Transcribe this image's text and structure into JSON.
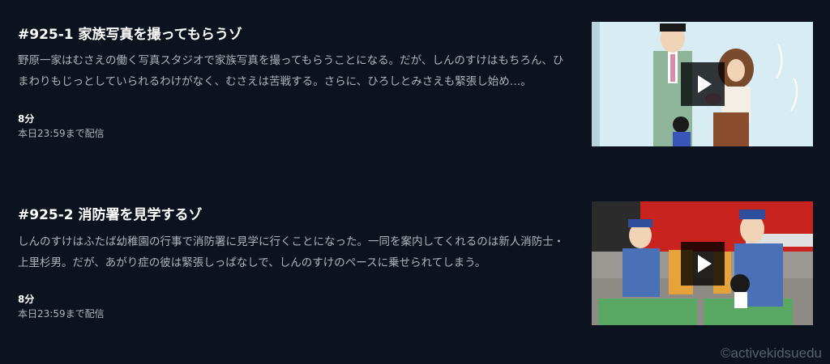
{
  "episodes": [
    {
      "title": "#925-1 家族写真を撮ってもらうゾ",
      "description": "野原一家はむさえの働く写真スタジオで家族写真を撮ってもらうことになる。だが、しんのすけはもちろん、ひまわりもじっとしていられるわけがなく、むさえは苦戦する。さらに、ひろしとみさえも緊張し始め…。",
      "duration": "8分",
      "availability": "本日23:59まで配信",
      "thumbnail_icon": "play-icon"
    },
    {
      "title": "#925-2 消防署を見学するゾ",
      "description": "しんのすけはふたば幼稚園の行事で消防署に見学に行くことになった。一同を案内してくれるのは新人消防士・上里杉男。だが、あがり症の彼は緊張しっぱなしで、しんのすけのペースに乗せられてしまう。",
      "duration": "8分",
      "availability": "本日23:59まで配信",
      "thumbnail_icon": "play-icon"
    }
  ],
  "watermark": "©activekidsuedu",
  "colors": {
    "background": "#0c131f",
    "title": "#ffffff",
    "description": "#aeb2b9"
  }
}
